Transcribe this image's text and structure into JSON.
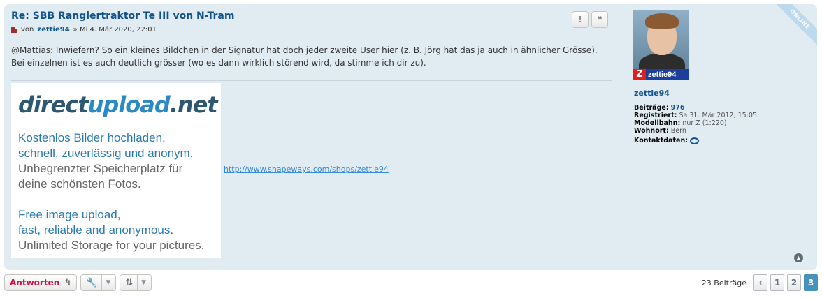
{
  "post": {
    "title": "Re: SBB Rangiertraktor Te III von N-Tram",
    "meta_prefix": "von",
    "author": "zettie94",
    "meta_date": "» Mi 4. Mär 2020, 22:01",
    "text": "@Mattias: Inwiefern? So ein kleines Bildchen in der Signatur hat doch jeder zweite User hier (z. B. Jörg hat das ja auch in ähnlicher Grösse). Bei einzelnen ist es auch deutlich grösser (wo es dann wirklich störend wird, da stimme ich dir zu).",
    "report_icon": "!",
    "quote_icon": "❝",
    "online_label": "ONLINE"
  },
  "signature": {
    "logo_part1": "direct",
    "logo_part2": "upload",
    "logo_part3": ".net",
    "lines": [
      "Kostenlos Bilder hochladen,",
      "schnell, zuverlässig und anonym.",
      "Unbegrenzter Speicherplatz für",
      "deine schönsten Fotos.",
      "Free image upload,",
      "fast, reliable and anonymous.",
      "Unlimited Storage for your pictures."
    ],
    "link": "http://www.shapeways.com/shops/zettie94"
  },
  "profile": {
    "badge_letter": "Z",
    "badge_name": "zettie94",
    "username": "zettie94",
    "posts_label": "Beiträge:",
    "posts_value": "976",
    "registered_label": "Registriert:",
    "registered_value": "Sa 31. Mär 2012, 15:05",
    "modellbahn_label": "Modellbahn:",
    "modellbahn_value": "nur Z (1:220)",
    "wohnort_label": "Wohnort:",
    "wohnort_value": "Bern",
    "contact_label": "Kontaktdaten:"
  },
  "actions": {
    "reply_label": "Antworten",
    "reply_icon": "↰",
    "tools_icon": "🔧",
    "sort_icon": "⇅",
    "caret": "▼",
    "top_icon": "▲"
  },
  "pagination": {
    "count": "23 Beiträge",
    "prev": "‹",
    "pages": [
      "1",
      "2",
      "3"
    ],
    "active_page": "3"
  }
}
